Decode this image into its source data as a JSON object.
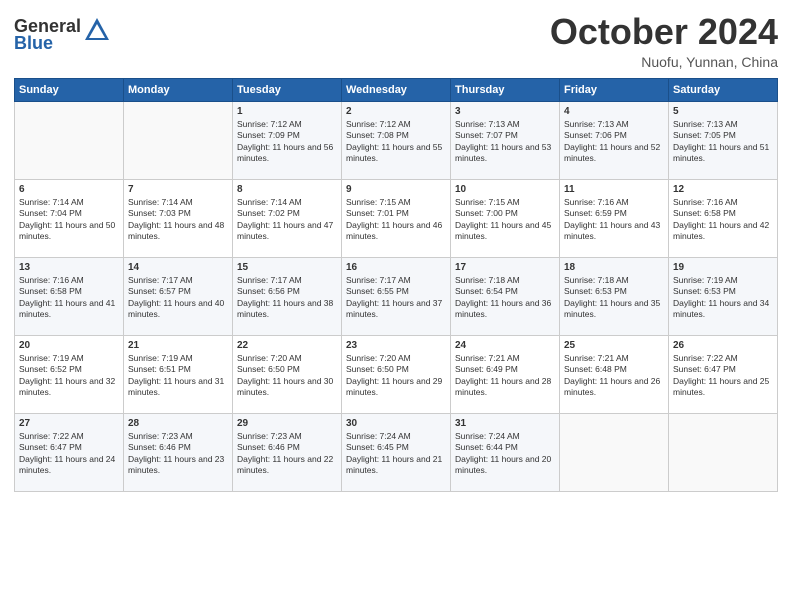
{
  "header": {
    "logo_line1": "General",
    "logo_line2": "Blue",
    "month": "October 2024",
    "location": "Nuofu, Yunnan, China"
  },
  "days_of_week": [
    "Sunday",
    "Monday",
    "Tuesday",
    "Wednesday",
    "Thursday",
    "Friday",
    "Saturday"
  ],
  "weeks": [
    [
      {
        "day": "",
        "sunrise": "",
        "sunset": "",
        "daylight": ""
      },
      {
        "day": "",
        "sunrise": "",
        "sunset": "",
        "daylight": ""
      },
      {
        "day": "1",
        "sunrise": "Sunrise: 7:12 AM",
        "sunset": "Sunset: 7:09 PM",
        "daylight": "Daylight: 11 hours and 56 minutes."
      },
      {
        "day": "2",
        "sunrise": "Sunrise: 7:12 AM",
        "sunset": "Sunset: 7:08 PM",
        "daylight": "Daylight: 11 hours and 55 minutes."
      },
      {
        "day": "3",
        "sunrise": "Sunrise: 7:13 AM",
        "sunset": "Sunset: 7:07 PM",
        "daylight": "Daylight: 11 hours and 53 minutes."
      },
      {
        "day": "4",
        "sunrise": "Sunrise: 7:13 AM",
        "sunset": "Sunset: 7:06 PM",
        "daylight": "Daylight: 11 hours and 52 minutes."
      },
      {
        "day": "5",
        "sunrise": "Sunrise: 7:13 AM",
        "sunset": "Sunset: 7:05 PM",
        "daylight": "Daylight: 11 hours and 51 minutes."
      }
    ],
    [
      {
        "day": "6",
        "sunrise": "Sunrise: 7:14 AM",
        "sunset": "Sunset: 7:04 PM",
        "daylight": "Daylight: 11 hours and 50 minutes."
      },
      {
        "day": "7",
        "sunrise": "Sunrise: 7:14 AM",
        "sunset": "Sunset: 7:03 PM",
        "daylight": "Daylight: 11 hours and 48 minutes."
      },
      {
        "day": "8",
        "sunrise": "Sunrise: 7:14 AM",
        "sunset": "Sunset: 7:02 PM",
        "daylight": "Daylight: 11 hours and 47 minutes."
      },
      {
        "day": "9",
        "sunrise": "Sunrise: 7:15 AM",
        "sunset": "Sunset: 7:01 PM",
        "daylight": "Daylight: 11 hours and 46 minutes."
      },
      {
        "day": "10",
        "sunrise": "Sunrise: 7:15 AM",
        "sunset": "Sunset: 7:00 PM",
        "daylight": "Daylight: 11 hours and 45 minutes."
      },
      {
        "day": "11",
        "sunrise": "Sunrise: 7:16 AM",
        "sunset": "Sunset: 6:59 PM",
        "daylight": "Daylight: 11 hours and 43 minutes."
      },
      {
        "day": "12",
        "sunrise": "Sunrise: 7:16 AM",
        "sunset": "Sunset: 6:58 PM",
        "daylight": "Daylight: 11 hours and 42 minutes."
      }
    ],
    [
      {
        "day": "13",
        "sunrise": "Sunrise: 7:16 AM",
        "sunset": "Sunset: 6:58 PM",
        "daylight": "Daylight: 11 hours and 41 minutes."
      },
      {
        "day": "14",
        "sunrise": "Sunrise: 7:17 AM",
        "sunset": "Sunset: 6:57 PM",
        "daylight": "Daylight: 11 hours and 40 minutes."
      },
      {
        "day": "15",
        "sunrise": "Sunrise: 7:17 AM",
        "sunset": "Sunset: 6:56 PM",
        "daylight": "Daylight: 11 hours and 38 minutes."
      },
      {
        "day": "16",
        "sunrise": "Sunrise: 7:17 AM",
        "sunset": "Sunset: 6:55 PM",
        "daylight": "Daylight: 11 hours and 37 minutes."
      },
      {
        "day": "17",
        "sunrise": "Sunrise: 7:18 AM",
        "sunset": "Sunset: 6:54 PM",
        "daylight": "Daylight: 11 hours and 36 minutes."
      },
      {
        "day": "18",
        "sunrise": "Sunrise: 7:18 AM",
        "sunset": "Sunset: 6:53 PM",
        "daylight": "Daylight: 11 hours and 35 minutes."
      },
      {
        "day": "19",
        "sunrise": "Sunrise: 7:19 AM",
        "sunset": "Sunset: 6:53 PM",
        "daylight": "Daylight: 11 hours and 34 minutes."
      }
    ],
    [
      {
        "day": "20",
        "sunrise": "Sunrise: 7:19 AM",
        "sunset": "Sunset: 6:52 PM",
        "daylight": "Daylight: 11 hours and 32 minutes."
      },
      {
        "day": "21",
        "sunrise": "Sunrise: 7:19 AM",
        "sunset": "Sunset: 6:51 PM",
        "daylight": "Daylight: 11 hours and 31 minutes."
      },
      {
        "day": "22",
        "sunrise": "Sunrise: 7:20 AM",
        "sunset": "Sunset: 6:50 PM",
        "daylight": "Daylight: 11 hours and 30 minutes."
      },
      {
        "day": "23",
        "sunrise": "Sunrise: 7:20 AM",
        "sunset": "Sunset: 6:50 PM",
        "daylight": "Daylight: 11 hours and 29 minutes."
      },
      {
        "day": "24",
        "sunrise": "Sunrise: 7:21 AM",
        "sunset": "Sunset: 6:49 PM",
        "daylight": "Daylight: 11 hours and 28 minutes."
      },
      {
        "day": "25",
        "sunrise": "Sunrise: 7:21 AM",
        "sunset": "Sunset: 6:48 PM",
        "daylight": "Daylight: 11 hours and 26 minutes."
      },
      {
        "day": "26",
        "sunrise": "Sunrise: 7:22 AM",
        "sunset": "Sunset: 6:47 PM",
        "daylight": "Daylight: 11 hours and 25 minutes."
      }
    ],
    [
      {
        "day": "27",
        "sunrise": "Sunrise: 7:22 AM",
        "sunset": "Sunset: 6:47 PM",
        "daylight": "Daylight: 11 hours and 24 minutes."
      },
      {
        "day": "28",
        "sunrise": "Sunrise: 7:23 AM",
        "sunset": "Sunset: 6:46 PM",
        "daylight": "Daylight: 11 hours and 23 minutes."
      },
      {
        "day": "29",
        "sunrise": "Sunrise: 7:23 AM",
        "sunset": "Sunset: 6:46 PM",
        "daylight": "Daylight: 11 hours and 22 minutes."
      },
      {
        "day": "30",
        "sunrise": "Sunrise: 7:24 AM",
        "sunset": "Sunset: 6:45 PM",
        "daylight": "Daylight: 11 hours and 21 minutes."
      },
      {
        "day": "31",
        "sunrise": "Sunrise: 7:24 AM",
        "sunset": "Sunset: 6:44 PM",
        "daylight": "Daylight: 11 hours and 20 minutes."
      },
      {
        "day": "",
        "sunrise": "",
        "sunset": "",
        "daylight": ""
      },
      {
        "day": "",
        "sunrise": "",
        "sunset": "",
        "daylight": ""
      }
    ]
  ]
}
